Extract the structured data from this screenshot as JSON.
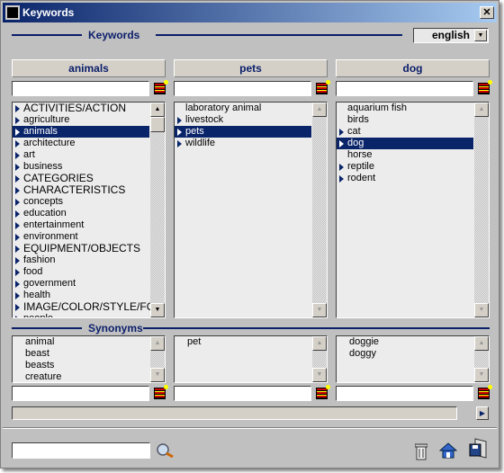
{
  "window": {
    "title": "Keywords"
  },
  "keywords_section": {
    "label": "Keywords",
    "language": "english"
  },
  "columns": [
    {
      "header": "animals",
      "items": [
        {
          "label": "ACTIVITIES/ACTION",
          "arrow": true
        },
        {
          "label": "agriculture",
          "arrow": true
        },
        {
          "label": "animals",
          "arrow": true,
          "selected": true
        },
        {
          "label": "architecture",
          "arrow": true
        },
        {
          "label": "art",
          "arrow": true
        },
        {
          "label": "business",
          "arrow": true
        },
        {
          "label": "CATEGORIES",
          "arrow": true
        },
        {
          "label": "CHARACTERISTICS",
          "arrow": true
        },
        {
          "label": "concepts",
          "arrow": true
        },
        {
          "label": "education",
          "arrow": true
        },
        {
          "label": "entertainment",
          "arrow": true
        },
        {
          "label": "environment",
          "arrow": true
        },
        {
          "label": "EQUIPMENT/OBJECTS",
          "arrow": true
        },
        {
          "label": "fashion",
          "arrow": true
        },
        {
          "label": "food",
          "arrow": true
        },
        {
          "label": "government",
          "arrow": true
        },
        {
          "label": "health",
          "arrow": true
        },
        {
          "label": "IMAGE/COLOR/STYLE/FOR",
          "arrow": true
        },
        {
          "label": "people",
          "arrow": true
        }
      ],
      "synonyms": [
        "animal",
        "beast",
        "beasts",
        "creature"
      ]
    },
    {
      "header": "pets",
      "items": [
        {
          "label": "laboratory animal",
          "arrow": false
        },
        {
          "label": "livestock",
          "arrow": true
        },
        {
          "label": "pets",
          "arrow": true,
          "selected": true
        },
        {
          "label": "wildlife",
          "arrow": true
        }
      ],
      "synonyms": [
        "pet"
      ]
    },
    {
      "header": "dog",
      "items": [
        {
          "label": "aquarium fish",
          "arrow": false
        },
        {
          "label": "birds",
          "arrow": false
        },
        {
          "label": "cat",
          "arrow": true
        },
        {
          "label": "dog",
          "arrow": true,
          "selected": true
        },
        {
          "label": "horse",
          "arrow": false
        },
        {
          "label": "reptile",
          "arrow": true
        },
        {
          "label": "rodent",
          "arrow": true
        }
      ],
      "synonyms": [
        "doggie",
        "doggy"
      ]
    }
  ],
  "synonyms_section": {
    "label": "Synonyms"
  },
  "colors": {
    "accent": "#0a246a",
    "window": "#c0c0c0"
  }
}
